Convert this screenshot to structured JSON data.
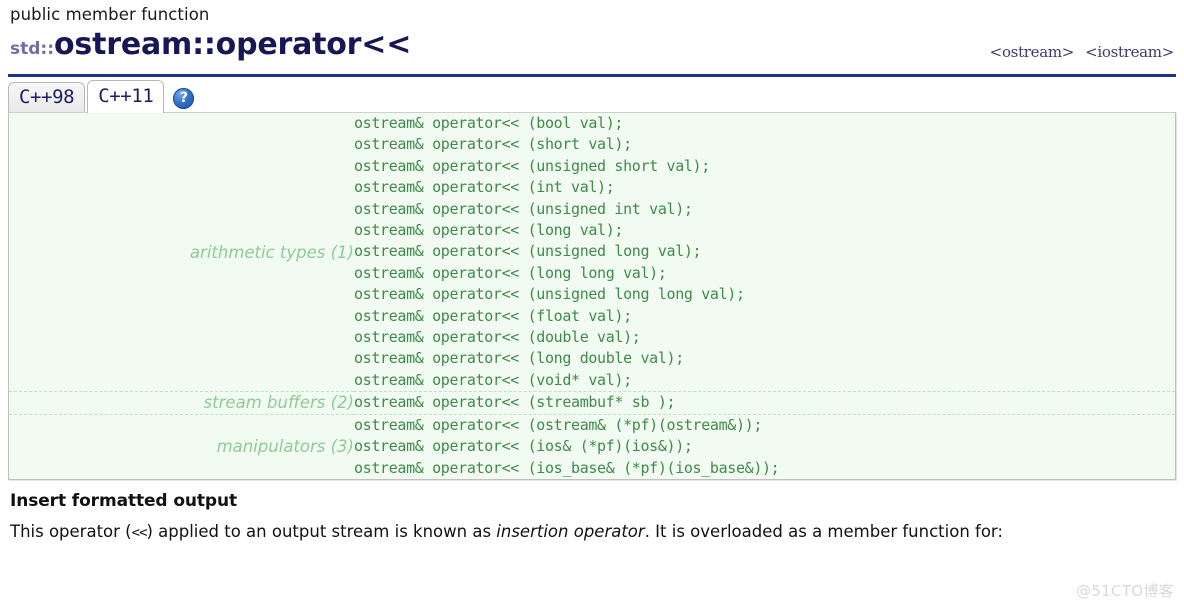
{
  "header": {
    "kind": "public member function",
    "namespace": "std::",
    "title": "ostream::operator<<",
    "links": [
      {
        "label": "<ostream>"
      },
      {
        "label": "<iostream>"
      }
    ]
  },
  "tabs": [
    {
      "label": "C++98",
      "active": false
    },
    {
      "label": "C++11",
      "active": true
    }
  ],
  "help": {
    "glyph": "?",
    "icon": "help-circle-icon"
  },
  "prototypes": {
    "groups": [
      {
        "label": "arithmetic types (1)",
        "signatures": [
          "ostream& operator<< (bool val);",
          "ostream& operator<< (short val);",
          "ostream& operator<< (unsigned short val);",
          "ostream& operator<< (int val);",
          "ostream& operator<< (unsigned int val);",
          "ostream& operator<< (long val);",
          "ostream& operator<< (unsigned long val);",
          "ostream& operator<< (long long val);",
          "ostream& operator<< (unsigned long long val);",
          "ostream& operator<< (float val);",
          "ostream& operator<< (double val);",
          "ostream& operator<< (long double val);",
          "ostream& operator<< (void* val);"
        ]
      },
      {
        "label": "stream buffers (2)",
        "signatures": [
          "ostream& operator<< (streambuf* sb );"
        ]
      },
      {
        "label": "manipulators (3)",
        "signatures": [
          "ostream& operator<< (ostream& (*pf)(ostream&));",
          "ostream& operator<< (ios& (*pf)(ios&));",
          "ostream& operator<< (ios_base& (*pf)(ios_base&));"
        ]
      }
    ]
  },
  "description": {
    "heading": "Insert formatted output",
    "text_part1": "This operator (",
    "operator_symbol": "<<",
    "text_part2": ") applied to an output stream is known as ",
    "emphasis": "insertion operator",
    "text_part3": ". It is overloaded as a member function for:"
  },
  "watermark": "@51CTO博客",
  "colors": {
    "title": "#171755",
    "namespace": "#6f6fa8",
    "rule": "#18348c",
    "code_text": "#3f8a4b",
    "code_background": "#f2fbf2",
    "group_label": "#8fcb96",
    "tab_text": "#1d1d6b",
    "help_icon": "#2f6fc7"
  }
}
